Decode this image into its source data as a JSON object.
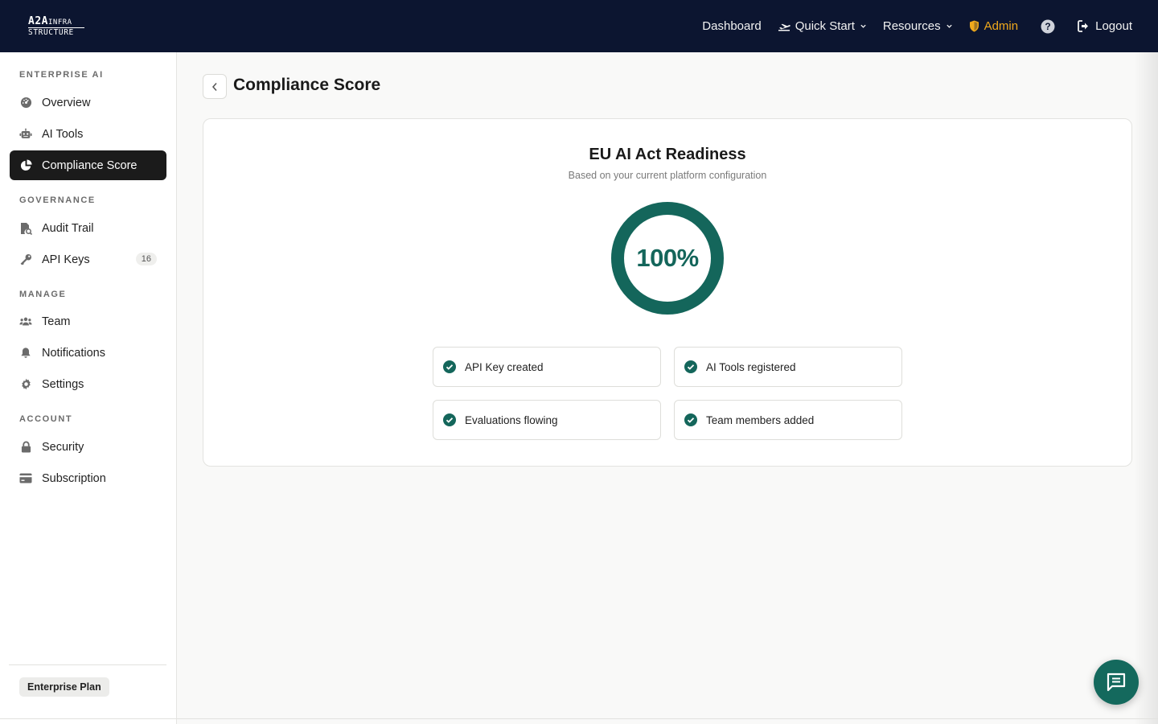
{
  "brand": {
    "line1": "A2A",
    "line1_suffix": "INFRA",
    "line2": "STRUCTURE"
  },
  "nav": {
    "dashboard": "Dashboard",
    "quick_start": "Quick Start",
    "resources": "Resources",
    "admin": "Admin",
    "logout": "Logout"
  },
  "sidebar": {
    "sections": [
      {
        "label": "ENTERPRISE AI"
      },
      {
        "label": "GOVERNANCE"
      },
      {
        "label": "MANAGE"
      },
      {
        "label": "ACCOUNT"
      }
    ],
    "items": [
      {
        "label": "Overview",
        "icon": "gauge-icon"
      },
      {
        "label": "AI Tools",
        "icon": "robot-icon"
      },
      {
        "label": "Compliance Score",
        "icon": "pie-chart-icon",
        "active": true
      },
      {
        "label": "Audit Trail",
        "icon": "file-search-icon"
      },
      {
        "label": "API Keys",
        "icon": "key-icon",
        "badge": "16"
      },
      {
        "label": "Team",
        "icon": "users-icon"
      },
      {
        "label": "Notifications",
        "icon": "bell-icon"
      },
      {
        "label": "Settings",
        "icon": "gear-icon"
      },
      {
        "label": "Security",
        "icon": "lock-icon"
      },
      {
        "label": "Subscription",
        "icon": "credit-card-icon"
      }
    ],
    "plan": "Enterprise Plan"
  },
  "page": {
    "title": "Compliance Score",
    "card": {
      "title": "EU AI Act Readiness",
      "subtitle": "Based on your current platform configuration",
      "score_label": "100%",
      "score_value": 100,
      "checks": [
        {
          "label": "API Key created",
          "done": true
        },
        {
          "label": "AI Tools registered",
          "done": true
        },
        {
          "label": "Evaluations flowing",
          "done": true
        },
        {
          "label": "Team members added",
          "done": true
        }
      ]
    }
  },
  "colors": {
    "accent": "#14665b",
    "nav_bg": "#0c1530",
    "admin": "#f0a91c"
  }
}
